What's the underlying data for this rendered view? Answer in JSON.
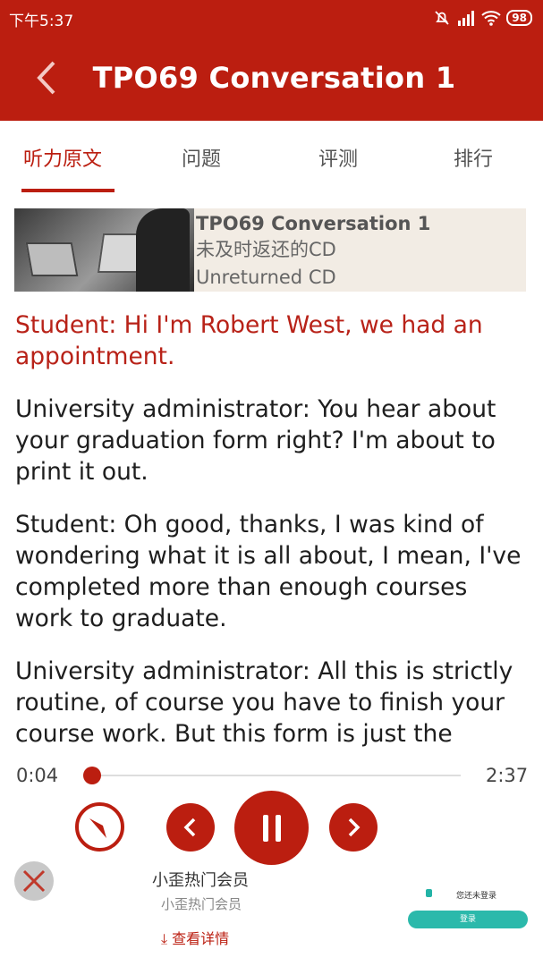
{
  "status_bar": {
    "time": "下午5:37",
    "battery": "98"
  },
  "header": {
    "title": "TPO69 Conversation 1"
  },
  "tabs": [
    {
      "label": "听力原文",
      "active": true
    },
    {
      "label": "问题",
      "active": false
    },
    {
      "label": "评测",
      "active": false
    },
    {
      "label": "排行",
      "active": false
    }
  ],
  "lesson": {
    "title": "TPO69 Conversation 1",
    "subtitle_cn": "未及时返还的CD",
    "subtitle_en": "Unreturned CD"
  },
  "transcript": [
    "Student: Hi I'm Robert West, we had an appointment.",
    "University administrator: You hear about your graduation form right? I'm about to print it out.",
    "Student: Oh good, thanks, I was kind of wondering what it is all about, I mean, I've completed more than enough courses work to graduate.",
    "University administrator: All this is strictly routine, of course you have to finish your course work. But this form is just the administrative checklist."
  ],
  "player": {
    "current_time": "0:04",
    "total_time": "2:37",
    "progress": 0.025
  },
  "ad": {
    "title": "小歪热门会员",
    "subtitle": "小歪热门会员",
    "link": "查看详情",
    "mini_status": "您还未登录",
    "mini_button": "登录"
  },
  "colors": {
    "accent": "#bb1e10",
    "active_text": "#b82218"
  }
}
